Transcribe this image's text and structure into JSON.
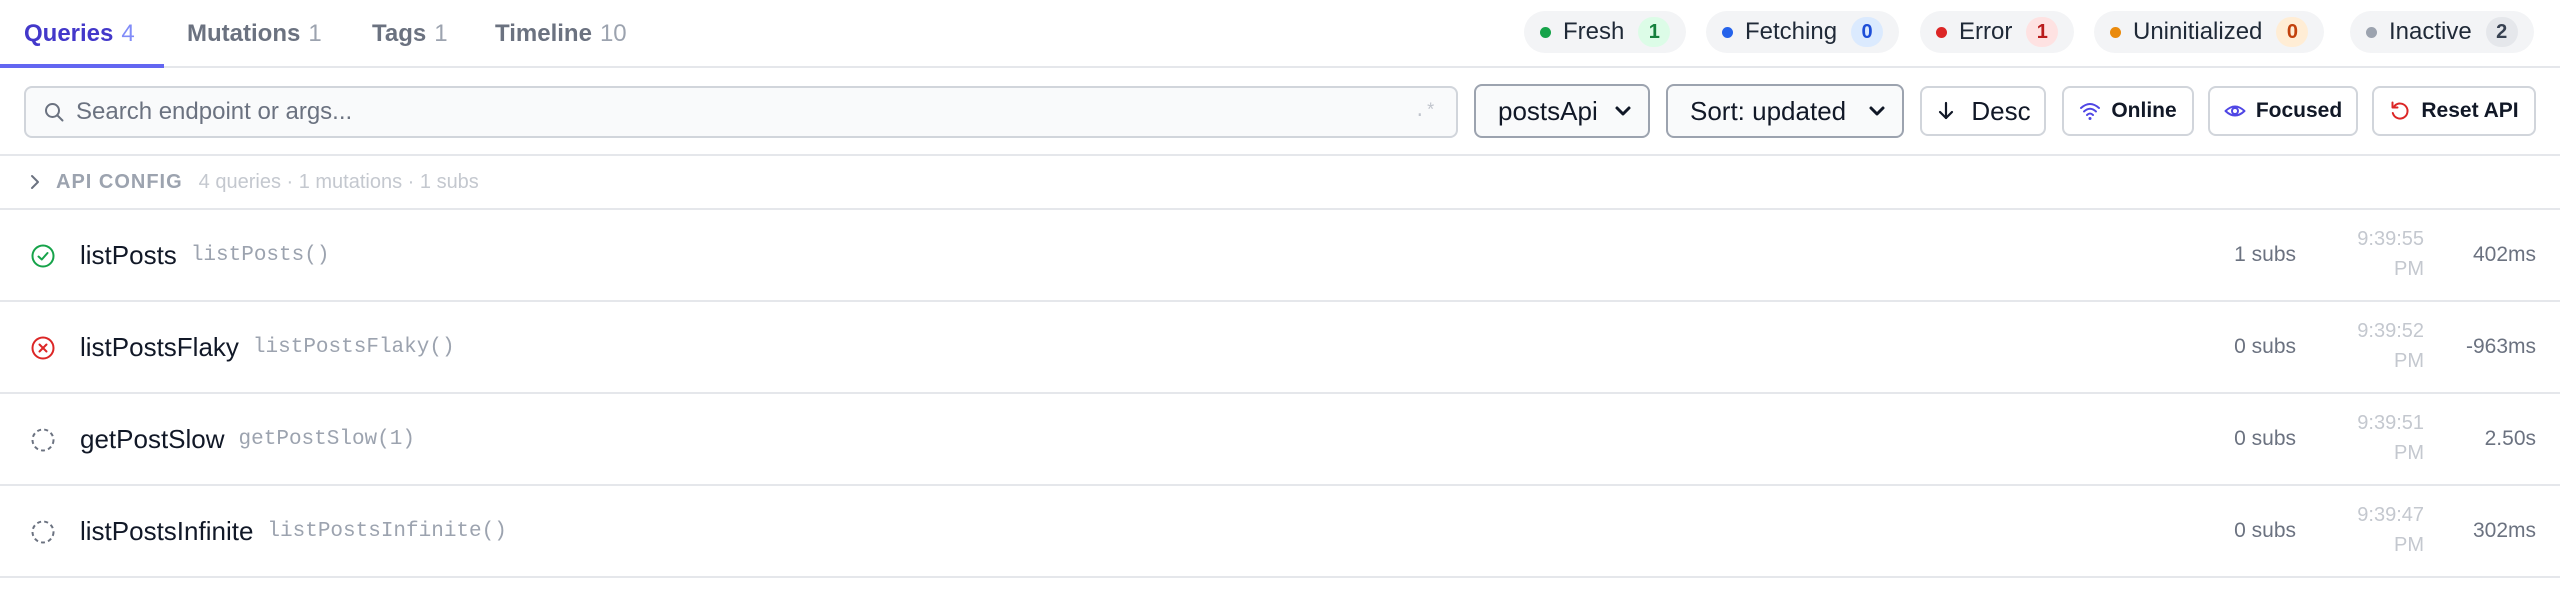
{
  "tabs": [
    {
      "label": "Queries",
      "count": "4"
    },
    {
      "label": "Mutations",
      "count": "1"
    },
    {
      "label": "Tags",
      "count": "1"
    },
    {
      "label": "Timeline",
      "count": "10"
    }
  ],
  "statuses": [
    {
      "label": "Fresh",
      "count": "1",
      "dot_color": "#16a34a",
      "badge_bg": "#dcfce7",
      "badge_color": "#15803d"
    },
    {
      "label": "Fetching",
      "count": "0",
      "dot_color": "#2563eb",
      "badge_bg": "#dbeafe",
      "badge_color": "#1d4ed8"
    },
    {
      "label": "Error",
      "count": "1",
      "dot_color": "#dc2626",
      "badge_bg": "#fee2e2",
      "badge_color": "#b91c1c"
    },
    {
      "label": "Uninitialized",
      "count": "0",
      "dot_color": "#ea8a0c",
      "badge_bg": "#ffedd5",
      "badge_color": "#c2410c"
    },
    {
      "label": "Inactive",
      "count": "2",
      "dot_color": "#9ca3af",
      "badge_bg": "#e5e7eb",
      "badge_color": "#374151"
    }
  ],
  "toolbar": {
    "search_placeholder": "Search endpoint or args...",
    "search_value": "",
    "regex_hint": ".*",
    "api_select": "postsApi",
    "sort_select": "Sort: updated",
    "desc_label": "Desc",
    "online_label": "Online",
    "focused_label": "Focused",
    "reset_label": "Reset API"
  },
  "config": {
    "title": "API CONFIG",
    "meta": "4 queries · 1 mutations · 1 subs"
  },
  "queries": [
    {
      "name": "listPosts",
      "call": "listPosts()",
      "status": "fulfilled",
      "icon": "check-circle-icon",
      "subs": "1 subs",
      "time_line1": "9:39:55",
      "time_line2": "PM",
      "duration": "402ms"
    },
    {
      "name": "listPostsFlaky",
      "call": "listPostsFlaky()",
      "status": "rejected",
      "icon": "x-circle-icon",
      "subs": "0 subs",
      "time_line1": "9:39:52",
      "time_line2": "PM",
      "duration": "-963ms"
    },
    {
      "name": "getPostSlow",
      "call": "getPostSlow(1)",
      "status": "inactive",
      "icon": "dashed-circle-icon",
      "subs": "0 subs",
      "time_line1": "9:39:51",
      "time_line2": "PM",
      "duration": "2.50s"
    },
    {
      "name": "listPostsInfinite",
      "call": "listPostsInfinite()",
      "status": "inactive",
      "icon": "dashed-circle-icon",
      "subs": "0 subs",
      "time_line1": "9:39:47",
      "time_line2": "PM",
      "duration": "302ms"
    }
  ],
  "colors": {
    "accent": "#4338ca",
    "fulfilled": "#16a34a",
    "rejected": "#dc2626",
    "inactive": "#6b7280"
  }
}
